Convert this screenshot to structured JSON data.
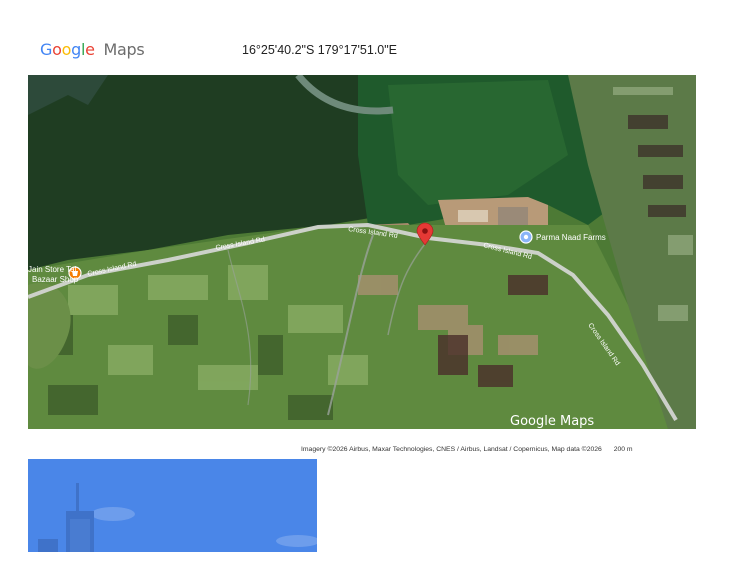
{
  "header": {
    "logo_google": "Google",
    "logo_maps": "Maps",
    "coordinates": "16°25'40.2\"S 179°17'51.0\"E"
  },
  "map": {
    "road_labels": [
      "Cross Island Rd",
      "Cross Island Rd",
      "Cross Island Rd",
      "Cross Island Rd",
      "Cross Island Rd"
    ],
    "pois": {
      "left": {
        "line1": "Jain Store Tal",
        "line2": "Bazaar Shop"
      },
      "right": {
        "label": "Parma Naad Farms"
      }
    },
    "watermark": "Google Maps",
    "pin_color": "#e53935"
  },
  "footer": {
    "attribution": "Imagery ©2026 Airbus, Maxar Technologies, CNES / Airbus, Landsat / Copernicus, Map data ©2026",
    "scale": "200 m"
  },
  "colors": {
    "streetview_sky": "#4a86e8",
    "building": "#3f72c9"
  }
}
